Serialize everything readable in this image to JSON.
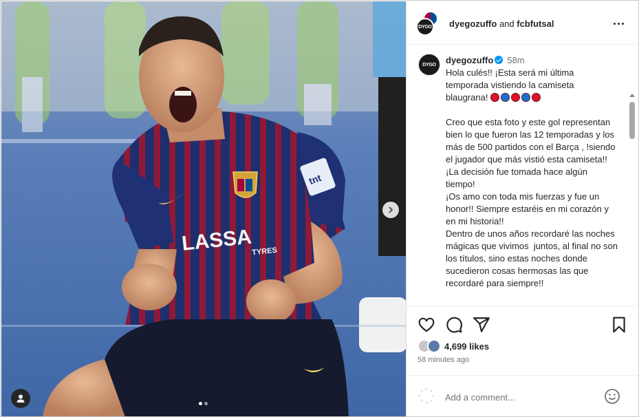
{
  "post": {
    "header": {
      "author": "dyegozuffo",
      "connector": "and",
      "coauthor": "fcbfutsal",
      "author_avatar_text": "DYGO"
    },
    "caption": {
      "username": "dyegozuffo",
      "time": "58m",
      "paragraphs": [
        "Hola culés!! ¡Esta será mi última temporada vistiendo la camiseta blaugrana!",
        "Creo que esta foto y este gol representan bien lo que fueron las 12 temporadas y los más de 500 partidos con el Barça , !siendo el jugador que más vistió esta camiseta!!\n¡La decisión fue tomada hace algún tiempo!\n¡Os amo con toda mis fuerzas y fue un honor!! Siempre estaréis en mi corazón y en mi historia!!\nDentro de unos años recordaré las noches mágicas que vivimos  juntos, al final no son los títulos, sino estas noches donde sucedieron cosas hermosas las que recordaré para siempre!!"
      ],
      "emoji_circles": [
        "#e0102a",
        "#1c6ed6",
        "#e0102a",
        "#1c6ed6",
        "#e0102a"
      ]
    },
    "likes_count": "4,699 likes",
    "time_ago": "58 minutes ago",
    "comment_placeholder": "Add a comment...",
    "media": {
      "sponsor_text": "LASSA",
      "sponsor_sub": "TYRES",
      "sleeve_text": "tnt",
      "carousel_dots": 2,
      "active_dot": 1
    }
  },
  "icons": {
    "like": "heart-icon",
    "comment": "comment-icon",
    "share": "share-icon",
    "save": "bookmark-icon",
    "more": "more-icon",
    "emoji": "emoji-icon",
    "next": "chevron-right-icon",
    "tag": "user-tag-icon"
  },
  "colors": {
    "verified": "#0095f6",
    "text_primary": "#262626",
    "text_secondary": "#737373",
    "barca_blue": "#004d98",
    "barca_red": "#a50044"
  }
}
